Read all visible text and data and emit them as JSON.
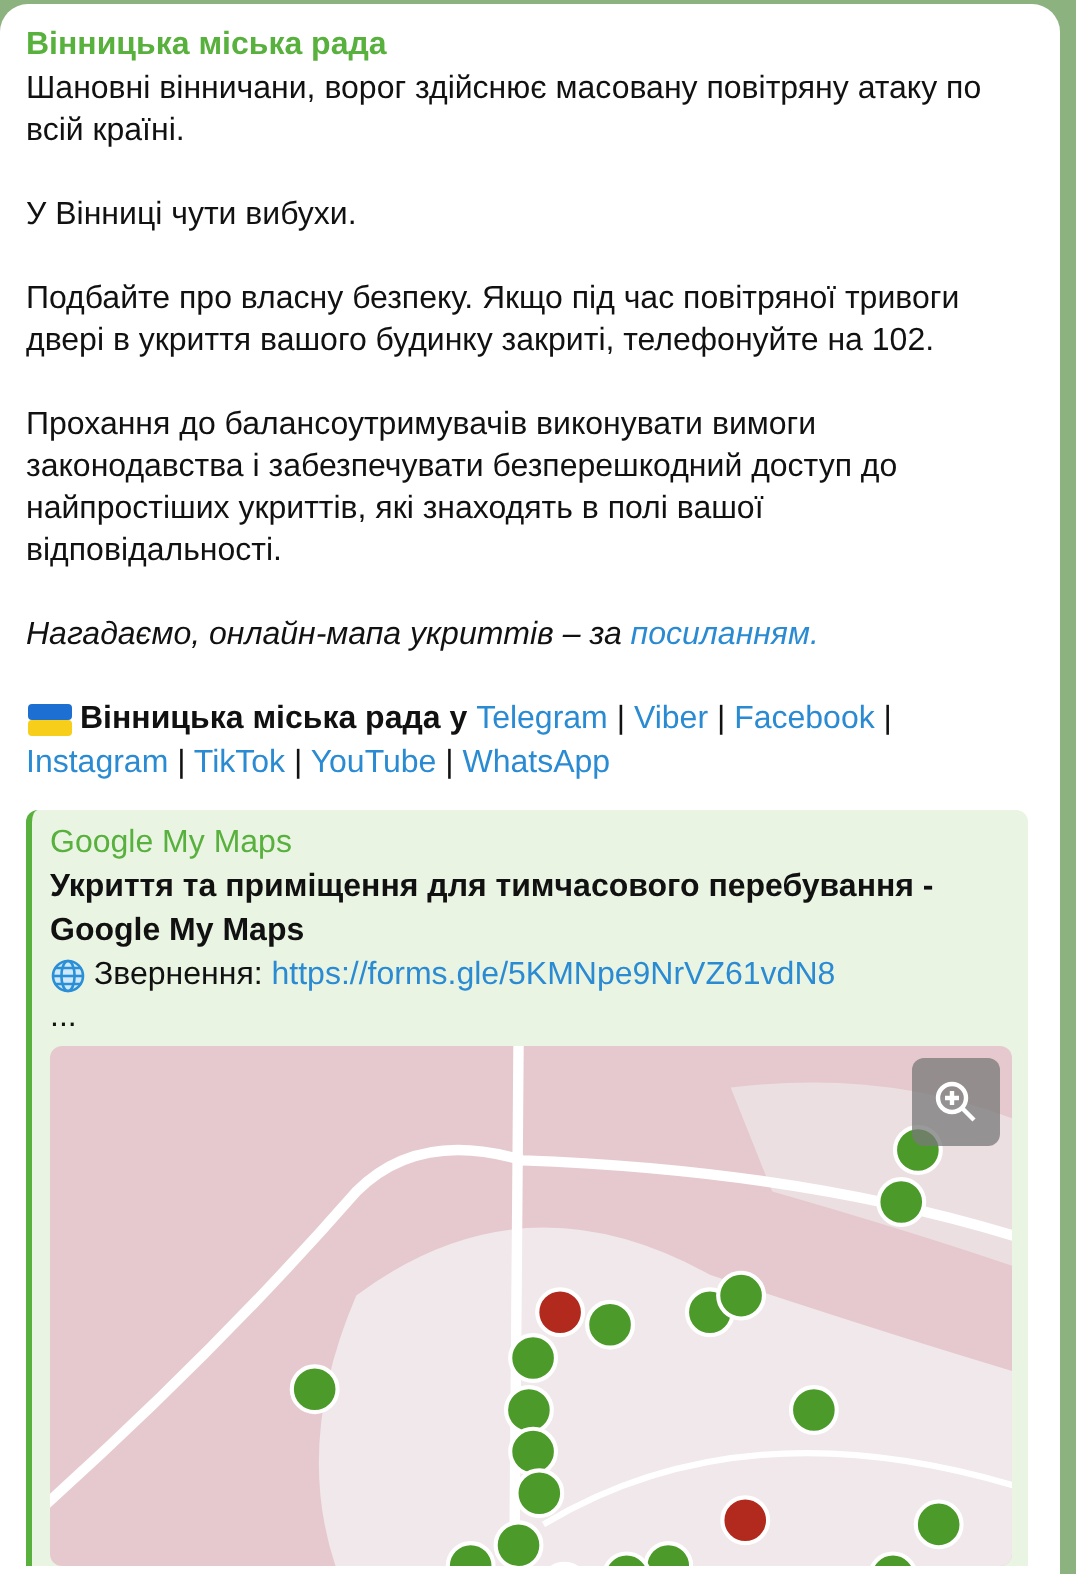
{
  "message": {
    "author": "Вінницька міська рада",
    "paragraphs": [
      "Шановні вінничани, ворог здійснює масовану повітряну атаку по всій країні.",
      "У Вінниці чути вибухи.",
      "Подбайте про власну безпеку. Якщо під час повітряної тривоги двері в укриття вашого будинку закриті, телефонуйте на 102.",
      "Прохання до балансоутримувачів виконувати вимоги законодавства і забезпечувати безперешкодний доступ до найпростіших укриттів, які знаходять в полі вашої відповідальності."
    ],
    "reminder": {
      "text": "Нагадаємо, онлайн-мапа укриттів – за ",
      "link": "посиланням."
    },
    "socials": {
      "lead": "Вінницька міська рада у",
      "separator": "|",
      "links": [
        "Telegram",
        "Viber",
        "Facebook",
        "Instagram",
        "TikTok",
        "YouTube",
        "WhatsApp"
      ]
    }
  },
  "link_preview": {
    "site": "Google My Maps",
    "title": "Укриття та приміщення для тимчасового перебування - Google My Maps",
    "description_label": "Звернення: ",
    "description_link": "https://forms.gle/5KMNpe9NrVZ61vdN8",
    "more": "..."
  }
}
